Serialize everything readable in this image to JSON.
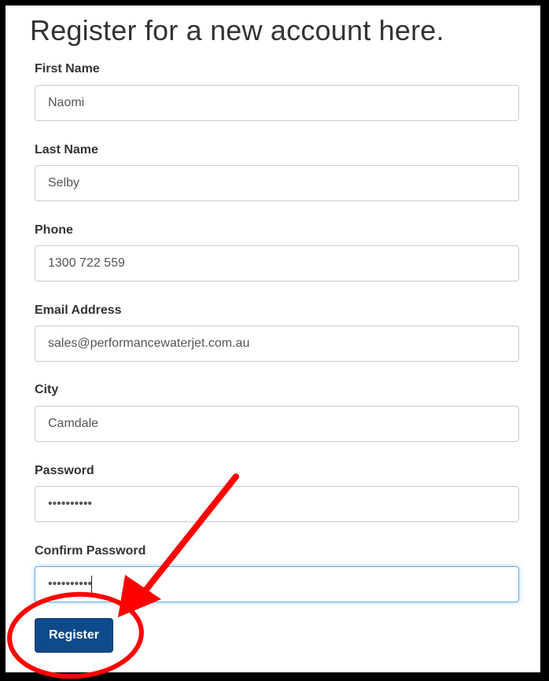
{
  "form": {
    "title": "Register for a new account here.",
    "fields": [
      {
        "label": "First Name",
        "value": "Naomi",
        "type": "text"
      },
      {
        "label": "Last Name",
        "value": "Selby",
        "type": "text"
      },
      {
        "label": "Phone",
        "value": "1300 722 559",
        "type": "text"
      },
      {
        "label": "Email Address",
        "value": "sales@performancewaterjet.com.au",
        "type": "text"
      },
      {
        "label": "City",
        "value": "Camdale",
        "type": "text"
      },
      {
        "label": "Password",
        "value": "••••••••••",
        "type": "password"
      },
      {
        "label": "Confirm Password",
        "value": "••••••••••",
        "type": "password",
        "focused": true
      }
    ],
    "submit_label": "Register"
  },
  "annotation": {
    "arrow_icon": "red-arrow-icon",
    "highlight_icon": "red-circle-highlight-icon",
    "color": "#ff0000"
  },
  "colors": {
    "primary_button": "#0f4a8a",
    "focus_border": "#66afe9"
  }
}
